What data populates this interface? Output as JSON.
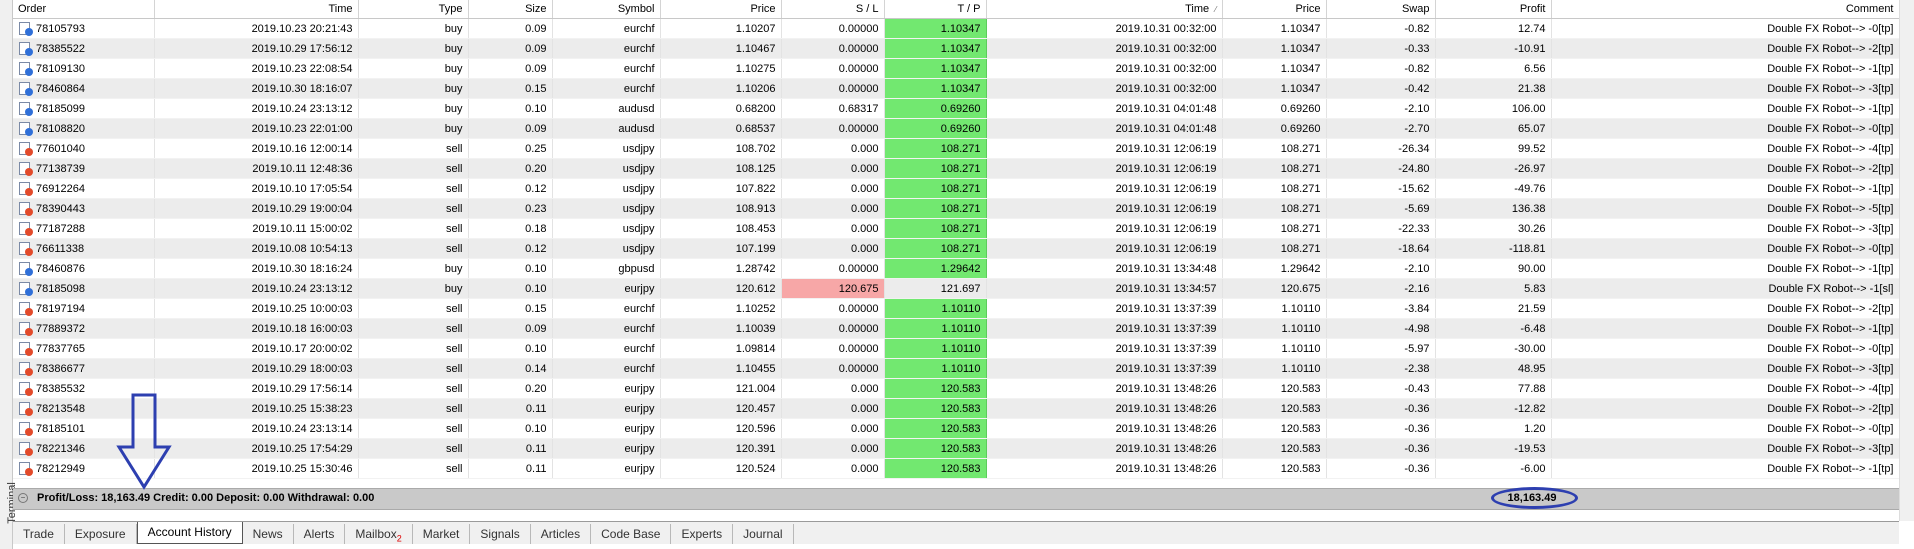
{
  "side_label": "Terminal",
  "columns": [
    "Order",
    "Time",
    "Type",
    "Size",
    "Symbol",
    "Price",
    "S / L",
    "T / P",
    "Time",
    "Price",
    "Swap",
    "Profit",
    "Comment"
  ],
  "rows": [
    {
      "order": "78105793",
      "type": "buy",
      "open_time": "2019.10.23 20:21:43",
      "size": "0.09",
      "symbol": "eurchf",
      "price": "1.10207",
      "sl": "0.00000",
      "tp": "1.10347",
      "close_time": "2019.10.31 00:32:00",
      "close_price": "1.10347",
      "swap": "-0.82",
      "profit": "12.74",
      "comment": "Double FX Robot--> -0[tp]"
    },
    {
      "order": "78385522",
      "type": "buy",
      "open_time": "2019.10.29 17:56:12",
      "size": "0.09",
      "symbol": "eurchf",
      "price": "1.10467",
      "sl": "0.00000",
      "tp": "1.10347",
      "close_time": "2019.10.31 00:32:00",
      "close_price": "1.10347",
      "swap": "-0.33",
      "profit": "-10.91",
      "comment": "Double FX Robot--> -2[tp]"
    },
    {
      "order": "78109130",
      "type": "buy",
      "open_time": "2019.10.23 22:08:54",
      "size": "0.09",
      "symbol": "eurchf",
      "price": "1.10275",
      "sl": "0.00000",
      "tp": "1.10347",
      "close_time": "2019.10.31 00:32:00",
      "close_price": "1.10347",
      "swap": "-0.82",
      "profit": "6.56",
      "comment": "Double FX Robot--> -1[tp]"
    },
    {
      "order": "78460864",
      "type": "buy",
      "open_time": "2019.10.30 18:16:07",
      "size": "0.15",
      "symbol": "eurchf",
      "price": "1.10206",
      "sl": "0.00000",
      "tp": "1.10347",
      "close_time": "2019.10.31 00:32:00",
      "close_price": "1.10347",
      "swap": "-0.42",
      "profit": "21.38",
      "comment": "Double FX Robot--> -3[tp]"
    },
    {
      "order": "78185099",
      "type": "buy",
      "open_time": "2019.10.24 23:13:12",
      "size": "0.10",
      "symbol": "audusd",
      "price": "0.68200",
      "sl": "0.68317",
      "tp": "0.69260",
      "close_time": "2019.10.31 04:01:48",
      "close_price": "0.69260",
      "swap": "-2.10",
      "profit": "106.00",
      "comment": "Double FX Robot--> -1[tp]"
    },
    {
      "order": "78108820",
      "type": "buy",
      "open_time": "2019.10.23 22:01:00",
      "size": "0.09",
      "symbol": "audusd",
      "price": "0.68537",
      "sl": "0.00000",
      "tp": "0.69260",
      "close_time": "2019.10.31 04:01:48",
      "close_price": "0.69260",
      "swap": "-2.70",
      "profit": "65.07",
      "comment": "Double FX Robot--> -0[tp]"
    },
    {
      "order": "77601040",
      "type": "sell",
      "open_time": "2019.10.16 12:00:14",
      "size": "0.25",
      "symbol": "usdjpy",
      "price": "108.702",
      "sl": "0.000",
      "tp": "108.271",
      "close_time": "2019.10.31 12:06:19",
      "close_price": "108.271",
      "swap": "-26.34",
      "profit": "99.52",
      "comment": "Double FX Robot--> -4[tp]"
    },
    {
      "order": "77138739",
      "type": "sell",
      "open_time": "2019.10.11 12:48:36",
      "size": "0.20",
      "symbol": "usdjpy",
      "price": "108.125",
      "sl": "0.000",
      "tp": "108.271",
      "close_time": "2019.10.31 12:06:19",
      "close_price": "108.271",
      "swap": "-24.80",
      "profit": "-26.97",
      "comment": "Double FX Robot--> -2[tp]"
    },
    {
      "order": "76912264",
      "type": "sell",
      "open_time": "2019.10.10 17:05:54",
      "size": "0.12",
      "symbol": "usdjpy",
      "price": "107.822",
      "sl": "0.000",
      "tp": "108.271",
      "close_time": "2019.10.31 12:06:19",
      "close_price": "108.271",
      "swap": "-15.62",
      "profit": "-49.76",
      "comment": "Double FX Robot--> -1[tp]"
    },
    {
      "order": "78390443",
      "type": "sell",
      "open_time": "2019.10.29 19:00:04",
      "size": "0.23",
      "symbol": "usdjpy",
      "price": "108.913",
      "sl": "0.000",
      "tp": "108.271",
      "close_time": "2019.10.31 12:06:19",
      "close_price": "108.271",
      "swap": "-5.69",
      "profit": "136.38",
      "comment": "Double FX Robot--> -5[tp]"
    },
    {
      "order": "77187288",
      "type": "sell",
      "open_time": "2019.10.11 15:00:02",
      "size": "0.18",
      "symbol": "usdjpy",
      "price": "108.453",
      "sl": "0.000",
      "tp": "108.271",
      "close_time": "2019.10.31 12:06:19",
      "close_price": "108.271",
      "swap": "-22.33",
      "profit": "30.26",
      "comment": "Double FX Robot--> -3[tp]"
    },
    {
      "order": "76611338",
      "type": "sell",
      "open_time": "2019.10.08 10:54:13",
      "size": "0.12",
      "symbol": "usdjpy",
      "price": "107.199",
      "sl": "0.000",
      "tp": "108.271",
      "close_time": "2019.10.31 12:06:19",
      "close_price": "108.271",
      "swap": "-18.64",
      "profit": "-118.81",
      "comment": "Double FX Robot--> -0[tp]"
    },
    {
      "order": "78460876",
      "type": "buy",
      "open_time": "2019.10.30 18:16:24",
      "size": "0.10",
      "symbol": "gbpusd",
      "price": "1.28742",
      "sl": "0.00000",
      "tp": "1.29642",
      "close_time": "2019.10.31 13:34:48",
      "close_price": "1.29642",
      "swap": "-2.10",
      "profit": "90.00",
      "comment": "Double FX Robot--> -1[tp]"
    },
    {
      "order": "78185098",
      "type": "buy",
      "open_time": "2019.10.24 23:13:12",
      "size": "0.10",
      "symbol": "eurjpy",
      "price": "120.612",
      "sl": "120.675",
      "tp": "121.697",
      "close_time": "2019.10.31 13:34:57",
      "close_price": "120.675",
      "swap": "-2.16",
      "profit": "5.83",
      "comment": "Double FX Robot--> -1[sl]",
      "sl_hit": true
    },
    {
      "order": "78197194",
      "type": "sell",
      "open_time": "2019.10.25 10:00:03",
      "size": "0.15",
      "symbol": "eurchf",
      "price": "1.10252",
      "sl": "0.00000",
      "tp": "1.10110",
      "close_time": "2019.10.31 13:37:39",
      "close_price": "1.10110",
      "swap": "-3.84",
      "profit": "21.59",
      "comment": "Double FX Robot--> -2[tp]"
    },
    {
      "order": "77889372",
      "type": "sell",
      "open_time": "2019.10.18 16:00:03",
      "size": "0.09",
      "symbol": "eurchf",
      "price": "1.10039",
      "sl": "0.00000",
      "tp": "1.10110",
      "close_time": "2019.10.31 13:37:39",
      "close_price": "1.10110",
      "swap": "-4.98",
      "profit": "-6.48",
      "comment": "Double FX Robot--> -1[tp]"
    },
    {
      "order": "77837765",
      "type": "sell",
      "open_time": "2019.10.17 20:00:02",
      "size": "0.10",
      "symbol": "eurchf",
      "price": "1.09814",
      "sl": "0.00000",
      "tp": "1.10110",
      "close_time": "2019.10.31 13:37:39",
      "close_price": "1.10110",
      "swap": "-5.97",
      "profit": "-30.00",
      "comment": "Double FX Robot--> -0[tp]"
    },
    {
      "order": "78386677",
      "type": "sell",
      "open_time": "2019.10.29 18:00:03",
      "size": "0.14",
      "symbol": "eurchf",
      "price": "1.10455",
      "sl": "0.00000",
      "tp": "1.10110",
      "close_time": "2019.10.31 13:37:39",
      "close_price": "1.10110",
      "swap": "-2.38",
      "profit": "48.95",
      "comment": "Double FX Robot--> -3[tp]"
    },
    {
      "order": "78385532",
      "type": "sell",
      "open_time": "2019.10.29 17:56:14",
      "size": "0.20",
      "symbol": "eurjpy",
      "price": "121.004",
      "sl": "0.000",
      "tp": "120.583",
      "close_time": "2019.10.31 13:48:26",
      "close_price": "120.583",
      "swap": "-0.43",
      "profit": "77.88",
      "comment": "Double FX Robot--> -4[tp]"
    },
    {
      "order": "78213548",
      "type": "sell",
      "open_time": "2019.10.25 15:38:23",
      "size": "0.11",
      "symbol": "eurjpy",
      "price": "120.457",
      "sl": "0.000",
      "tp": "120.583",
      "close_time": "2019.10.31 13:48:26",
      "close_price": "120.583",
      "swap": "-0.36",
      "profit": "-12.82",
      "comment": "Double FX Robot--> -2[tp]"
    },
    {
      "order": "78185101",
      "type": "sell",
      "open_time": "2019.10.24 23:13:14",
      "size": "0.10",
      "symbol": "eurjpy",
      "price": "120.596",
      "sl": "0.000",
      "tp": "120.583",
      "close_time": "2019.10.31 13:48:26",
      "close_price": "120.583",
      "swap": "-0.36",
      "profit": "1.20",
      "comment": "Double FX Robot--> -0[tp]"
    },
    {
      "order": "78221346",
      "type": "sell",
      "open_time": "2019.10.25 17:54:29",
      "size": "0.11",
      "symbol": "eurjpy",
      "price": "120.391",
      "sl": "0.000",
      "tp": "120.583",
      "close_time": "2019.10.31 13:48:26",
      "close_price": "120.583",
      "swap": "-0.36",
      "profit": "-19.53",
      "comment": "Double FX Robot--> -3[tp]"
    },
    {
      "order": "78212949",
      "type": "sell",
      "open_time": "2019.10.25 15:30:46",
      "size": "0.11",
      "symbol": "eurjpy",
      "price": "120.524",
      "sl": "0.000",
      "tp": "120.583",
      "close_time": "2019.10.31 13:48:26",
      "close_price": "120.583",
      "swap": "-0.36",
      "profit": "-6.00",
      "comment": "Double FX Robot--> -1[tp]"
    }
  ],
  "summary": {
    "text": "Profit/Loss: 18,163.49  Credit: 0.00  Deposit: 0.00  Withdrawal: 0.00",
    "total": "18,163.49"
  },
  "tabs": [
    {
      "label": "Trade"
    },
    {
      "label": "Exposure"
    },
    {
      "label": "Account History",
      "active": true
    },
    {
      "label": "News"
    },
    {
      "label": "Alerts"
    },
    {
      "label": "Mailbox",
      "badge": "2"
    },
    {
      "label": "Market"
    },
    {
      "label": "Signals"
    },
    {
      "label": "Articles"
    },
    {
      "label": "Code Base"
    },
    {
      "label": "Experts"
    },
    {
      "label": "Journal"
    }
  ],
  "colors": {
    "tp_green": "#72e870",
    "sl_red": "#f7a7a7",
    "annotation_blue": "#2d3fb0",
    "summary_bg": "#c9c9c9"
  },
  "icons": {
    "sort": "sort-indicator-icon",
    "buy": "buy-order-icon",
    "sell": "sell-order-icon",
    "annotation_arrow": "down-arrow-annotation-icon",
    "annotation_oval": "oval-highlight-annotation"
  }
}
